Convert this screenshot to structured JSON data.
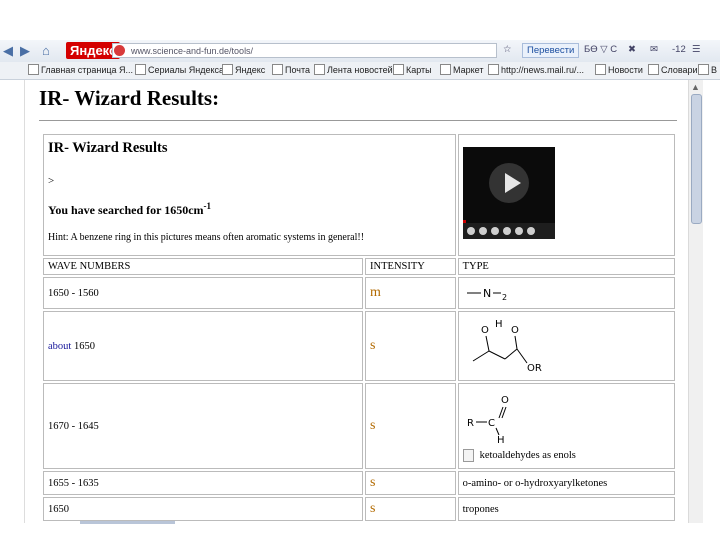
{
  "browser": {
    "site_logo": "Яндекс",
    "address": "www.science-and-fun.de/tools/",
    "translate_label": "Перевести",
    "nav_right_text": "БӨ ▽ C",
    "counter": "-12",
    "bookmarks": [
      "Главная страница Я...",
      "Сериалы Яндекса",
      "Яндекс",
      "Почта",
      "Лента новостей",
      "Карты",
      "Маркет",
      "http://news.mail.ru/...",
      "Новости",
      "Словари",
      "В"
    ]
  },
  "page": {
    "title": "IR- Wizard Results:",
    "subtitle": "IR- Wizard Results",
    "gt_symbol": ">",
    "searched_text": "You have searched for 1650cm",
    "searched_exp": "-1",
    "hint": "Hint: A benzene ring in this pictures means often aromatic systems in general!!"
  },
  "table": {
    "headers": [
      "WAVE NUMBERS",
      "INTENSITY",
      "TYPE"
    ],
    "rows": [
      {
        "wave": "1650 - 1560",
        "intensity": "m",
        "type_text": ""
      },
      {
        "wave_prefix": "about",
        "wave": "1650",
        "intensity": "s",
        "type_text": ""
      },
      {
        "wave": "1670 - 1645",
        "intensity": "s",
        "type_text": "ketoaldehydes as enols"
      },
      {
        "wave": "1655 - 1635",
        "intensity": "s",
        "type_text": "o-amino- or o-hydroxyarylketones"
      },
      {
        "wave": "1650",
        "intensity": "s",
        "type_text": "tropones"
      }
    ],
    "chem": {
      "amine": {
        "n": "N",
        "sub": "2"
      },
      "enol": {
        "o1": "O",
        "h": "H",
        "o2": "O",
        "r": "OR"
      },
      "aldehyde": {
        "o": "O",
        "r": "R",
        "c": "C",
        "h": "H"
      }
    }
  }
}
